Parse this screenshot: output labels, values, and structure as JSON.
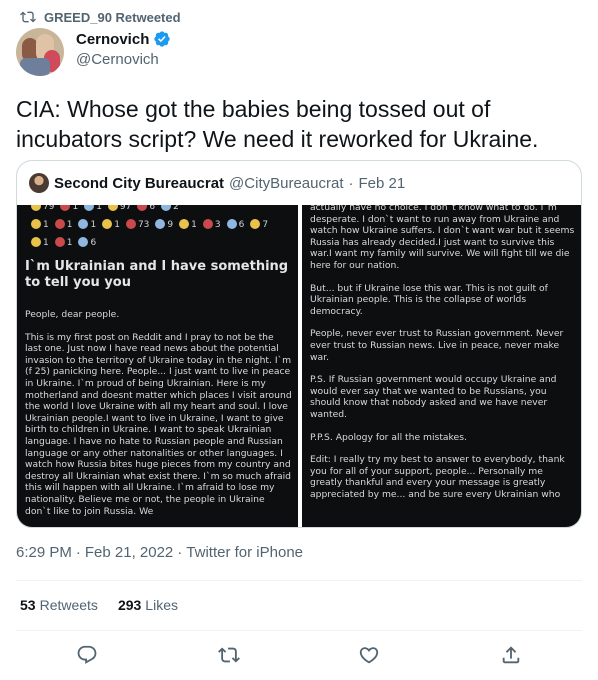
{
  "retweeted_by": {
    "icon": "retweet-icon",
    "text": "GREED_90 Retweeted"
  },
  "author": {
    "display_name": "Cernovich",
    "verified_icon": "verified-badge-icon",
    "handle": "@Cernovich"
  },
  "tweet": {
    "text": "CIA: Whose got the babies being tossed out of incubators script? We need it reworked for Ukraine."
  },
  "quoted_tweet": {
    "display_name": "Second City Bureaucrat",
    "handle": "@CityBureaucrat",
    "separator": "·",
    "date": "Feb 21",
    "left_image": {
      "emoji_row_0": [
        "79",
        "1",
        "1",
        "97",
        "6",
        "2"
      ],
      "emoji_row_1": [
        "1",
        "1",
        "1",
        "1",
        "73",
        "9",
        "1",
        "3",
        "6",
        "7"
      ],
      "emoji_row_2": [
        "1",
        "1",
        "6"
      ],
      "title": "I`m Ukrainian and I have something to tell you you",
      "paragraphs": [
        "People, dear people.",
        "This is my first post on Reddit and I pray to not be the last one. Just now I have read news about the potential invasion to the territory of Ukraine today in the night. I`m (f 25)  panicking here. People... I just want to live in peace in Ukraine. I`m proud of being Ukrainian. Here is my motherland and doesnt matter which places I visit around the world I love Ukraine with all my heart and soul. I love Ukrainian people.I want to live in Ukraine, I want to give birth to children in Ukraine. I want to speak Ukrainian language. I have no hate to Russian people and Russian language or any other natonalities or other languages. I watch how Russia bites huge pieces from my country and destroy all Ukrainian what exist there. I`m so much afraid this will happen with all Ukraine. I`m afraid to lose my nationality. Believe me or not, the people in Ukraine don`t like to join Russia. We"
      ]
    },
    "right_image": {
      "paragraphs": [
        "actually have no choice. I don`t know what to do. I`m desperate. I don`t want to run away from Ukraine and watch how Ukraine suffers. I don`t want war but it seems Russia has already decided.I just want to survive this war.I want my family will survive. We will fight till we die here for our nation.",
        "But... but if Ukraine lose this war. This is not guilt of Ukrainian people. This is the collapse of worlds democracy.",
        "People, never ever trust to Russian government. Never ever trust to Russian news. Live in peace, never make war.",
        "P.S. If Russian government would occupy Ukraine and would ever say that we wanted to be Russians, you should know that nobody asked and we have never wanted.",
        "P.P.S. Apology for all the mistakes.",
        "Edit: I really try my best to answer to everybody, thank you for all of your support, people... Personally me greatly thankful and every your message is greatly appreciated by me... and be sure every Ukrainian who"
      ]
    }
  },
  "meta": {
    "time": "6:29 PM",
    "separator": "·",
    "date": "Feb 21, 2022",
    "source": "Twitter for iPhone"
  },
  "stats": {
    "retweets_count": "53",
    "retweets_label": "Retweets",
    "likes_count": "293",
    "likes_label": "Likes"
  },
  "actions": {
    "reply_icon": "reply-icon",
    "retweet_icon": "retweet-icon",
    "like_icon": "heart-icon",
    "share_icon": "share-icon"
  },
  "colors": {
    "text_primary": "#0f1419",
    "text_secondary": "#536471",
    "verified_blue": "#1d9bf0",
    "border": "#cfd9de",
    "image_bg": "#0d0e10"
  }
}
